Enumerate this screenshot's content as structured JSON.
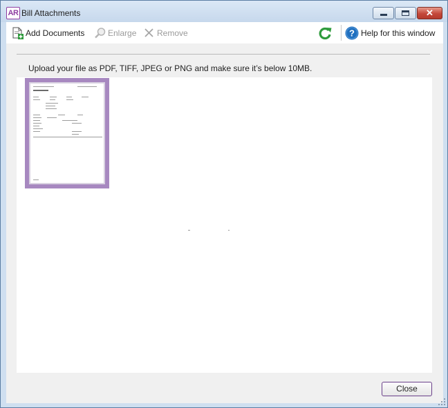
{
  "window": {
    "logo_text": "AR",
    "title": "Bill Attachments",
    "controls": {
      "close_glyph": "✕"
    }
  },
  "toolbar": {
    "add_documents_label": "Add Documents",
    "enlarge_label": "Enlarge",
    "remove_label": "Remove",
    "help_label": "Help for this window",
    "icons": {
      "add_documents": "add-document-icon",
      "enlarge": "magnifier-icon",
      "remove": "x-icon",
      "refresh": "refresh-icon",
      "help": "question-icon"
    }
  },
  "main": {
    "instruction": "Upload your file as PDF, TIFF, JPEG or PNG and make sure it’s below 10MB.",
    "attachments": [
      {
        "selected": true,
        "kind": "document-thumbnail"
      }
    ]
  },
  "footer": {
    "close_label": "Close"
  },
  "colors": {
    "accent": "#8e3da1",
    "thumbnail_selection": "#a788c0",
    "refresh_green": "#2e9b3c",
    "help_blue": "#1f6fbf"
  }
}
